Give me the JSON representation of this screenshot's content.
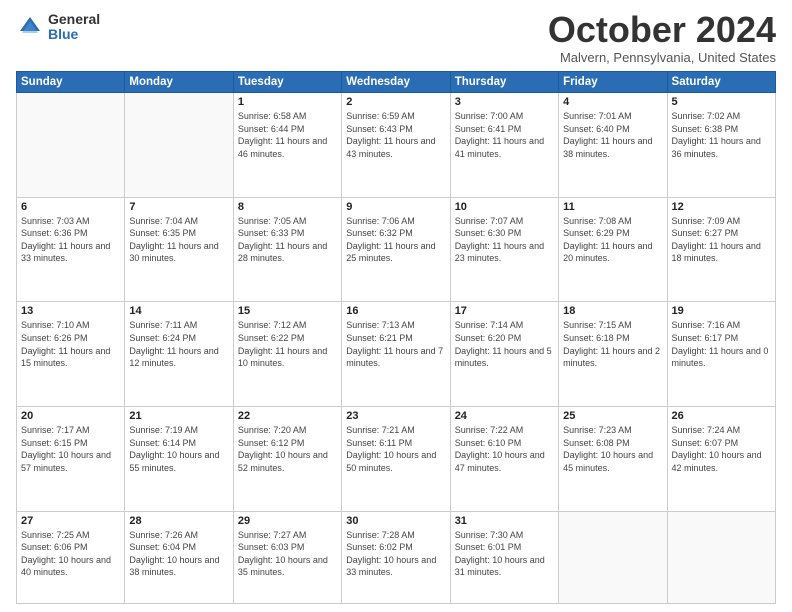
{
  "logo": {
    "general": "General",
    "blue": "Blue"
  },
  "title": "October 2024",
  "location": "Malvern, Pennsylvania, United States",
  "days_of_week": [
    "Sunday",
    "Monday",
    "Tuesday",
    "Wednesday",
    "Thursday",
    "Friday",
    "Saturday"
  ],
  "weeks": [
    [
      {
        "day": "",
        "sunrise": "",
        "sunset": "",
        "daylight": ""
      },
      {
        "day": "",
        "sunrise": "",
        "sunset": "",
        "daylight": ""
      },
      {
        "day": "1",
        "sunrise": "Sunrise: 6:58 AM",
        "sunset": "Sunset: 6:44 PM",
        "daylight": "Daylight: 11 hours and 46 minutes."
      },
      {
        "day": "2",
        "sunrise": "Sunrise: 6:59 AM",
        "sunset": "Sunset: 6:43 PM",
        "daylight": "Daylight: 11 hours and 43 minutes."
      },
      {
        "day": "3",
        "sunrise": "Sunrise: 7:00 AM",
        "sunset": "Sunset: 6:41 PM",
        "daylight": "Daylight: 11 hours and 41 minutes."
      },
      {
        "day": "4",
        "sunrise": "Sunrise: 7:01 AM",
        "sunset": "Sunset: 6:40 PM",
        "daylight": "Daylight: 11 hours and 38 minutes."
      },
      {
        "day": "5",
        "sunrise": "Sunrise: 7:02 AM",
        "sunset": "Sunset: 6:38 PM",
        "daylight": "Daylight: 11 hours and 36 minutes."
      }
    ],
    [
      {
        "day": "6",
        "sunrise": "Sunrise: 7:03 AM",
        "sunset": "Sunset: 6:36 PM",
        "daylight": "Daylight: 11 hours and 33 minutes."
      },
      {
        "day": "7",
        "sunrise": "Sunrise: 7:04 AM",
        "sunset": "Sunset: 6:35 PM",
        "daylight": "Daylight: 11 hours and 30 minutes."
      },
      {
        "day": "8",
        "sunrise": "Sunrise: 7:05 AM",
        "sunset": "Sunset: 6:33 PM",
        "daylight": "Daylight: 11 hours and 28 minutes."
      },
      {
        "day": "9",
        "sunrise": "Sunrise: 7:06 AM",
        "sunset": "Sunset: 6:32 PM",
        "daylight": "Daylight: 11 hours and 25 minutes."
      },
      {
        "day": "10",
        "sunrise": "Sunrise: 7:07 AM",
        "sunset": "Sunset: 6:30 PM",
        "daylight": "Daylight: 11 hours and 23 minutes."
      },
      {
        "day": "11",
        "sunrise": "Sunrise: 7:08 AM",
        "sunset": "Sunset: 6:29 PM",
        "daylight": "Daylight: 11 hours and 20 minutes."
      },
      {
        "day": "12",
        "sunrise": "Sunrise: 7:09 AM",
        "sunset": "Sunset: 6:27 PM",
        "daylight": "Daylight: 11 hours and 18 minutes."
      }
    ],
    [
      {
        "day": "13",
        "sunrise": "Sunrise: 7:10 AM",
        "sunset": "Sunset: 6:26 PM",
        "daylight": "Daylight: 11 hours and 15 minutes."
      },
      {
        "day": "14",
        "sunrise": "Sunrise: 7:11 AM",
        "sunset": "Sunset: 6:24 PM",
        "daylight": "Daylight: 11 hours and 12 minutes."
      },
      {
        "day": "15",
        "sunrise": "Sunrise: 7:12 AM",
        "sunset": "Sunset: 6:22 PM",
        "daylight": "Daylight: 11 hours and 10 minutes."
      },
      {
        "day": "16",
        "sunrise": "Sunrise: 7:13 AM",
        "sunset": "Sunset: 6:21 PM",
        "daylight": "Daylight: 11 hours and 7 minutes."
      },
      {
        "day": "17",
        "sunrise": "Sunrise: 7:14 AM",
        "sunset": "Sunset: 6:20 PM",
        "daylight": "Daylight: 11 hours and 5 minutes."
      },
      {
        "day": "18",
        "sunrise": "Sunrise: 7:15 AM",
        "sunset": "Sunset: 6:18 PM",
        "daylight": "Daylight: 11 hours and 2 minutes."
      },
      {
        "day": "19",
        "sunrise": "Sunrise: 7:16 AM",
        "sunset": "Sunset: 6:17 PM",
        "daylight": "Daylight: 11 hours and 0 minutes."
      }
    ],
    [
      {
        "day": "20",
        "sunrise": "Sunrise: 7:17 AM",
        "sunset": "Sunset: 6:15 PM",
        "daylight": "Daylight: 10 hours and 57 minutes."
      },
      {
        "day": "21",
        "sunrise": "Sunrise: 7:19 AM",
        "sunset": "Sunset: 6:14 PM",
        "daylight": "Daylight: 10 hours and 55 minutes."
      },
      {
        "day": "22",
        "sunrise": "Sunrise: 7:20 AM",
        "sunset": "Sunset: 6:12 PM",
        "daylight": "Daylight: 10 hours and 52 minutes."
      },
      {
        "day": "23",
        "sunrise": "Sunrise: 7:21 AM",
        "sunset": "Sunset: 6:11 PM",
        "daylight": "Daylight: 10 hours and 50 minutes."
      },
      {
        "day": "24",
        "sunrise": "Sunrise: 7:22 AM",
        "sunset": "Sunset: 6:10 PM",
        "daylight": "Daylight: 10 hours and 47 minutes."
      },
      {
        "day": "25",
        "sunrise": "Sunrise: 7:23 AM",
        "sunset": "Sunset: 6:08 PM",
        "daylight": "Daylight: 10 hours and 45 minutes."
      },
      {
        "day": "26",
        "sunrise": "Sunrise: 7:24 AM",
        "sunset": "Sunset: 6:07 PM",
        "daylight": "Daylight: 10 hours and 42 minutes."
      }
    ],
    [
      {
        "day": "27",
        "sunrise": "Sunrise: 7:25 AM",
        "sunset": "Sunset: 6:06 PM",
        "daylight": "Daylight: 10 hours and 40 minutes."
      },
      {
        "day": "28",
        "sunrise": "Sunrise: 7:26 AM",
        "sunset": "Sunset: 6:04 PM",
        "daylight": "Daylight: 10 hours and 38 minutes."
      },
      {
        "day": "29",
        "sunrise": "Sunrise: 7:27 AM",
        "sunset": "Sunset: 6:03 PM",
        "daylight": "Daylight: 10 hours and 35 minutes."
      },
      {
        "day": "30",
        "sunrise": "Sunrise: 7:28 AM",
        "sunset": "Sunset: 6:02 PM",
        "daylight": "Daylight: 10 hours and 33 minutes."
      },
      {
        "day": "31",
        "sunrise": "Sunrise: 7:30 AM",
        "sunset": "Sunset: 6:01 PM",
        "daylight": "Daylight: 10 hours and 31 minutes."
      },
      {
        "day": "",
        "sunrise": "",
        "sunset": "",
        "daylight": ""
      },
      {
        "day": "",
        "sunrise": "",
        "sunset": "",
        "daylight": ""
      }
    ]
  ]
}
